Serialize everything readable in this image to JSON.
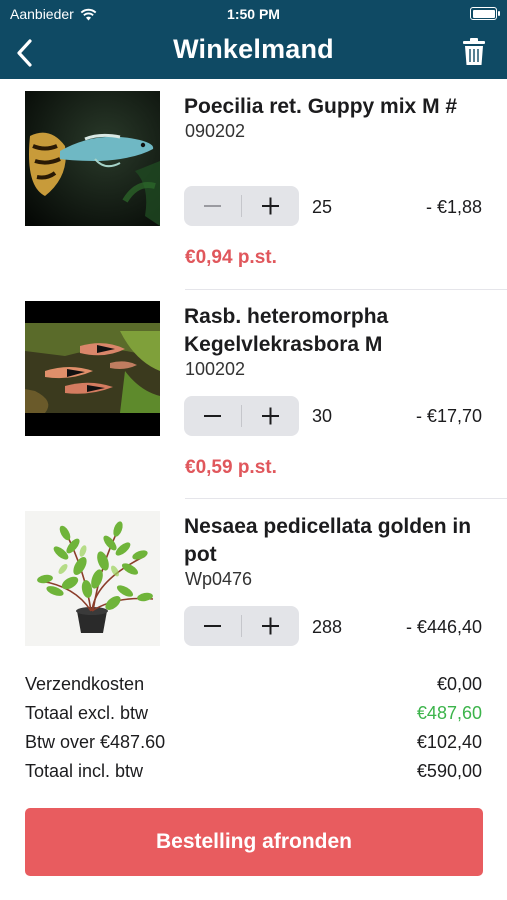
{
  "status_bar": {
    "carrier": "Aanbieder",
    "time": "1:50 PM"
  },
  "header": {
    "title": "Winkelmand",
    "back_icon": "chevron-left-icon",
    "delete_icon": "trash-icon",
    "background": "#0f4a64"
  },
  "items": [
    {
      "name": "Poecilia ret.   Guppy mix M #",
      "code": "090202",
      "quantity": "25",
      "line_total": "- €1,88",
      "unit_price": "€0,94 p.st.",
      "image": "guppy-fish-photo"
    },
    {
      "name": "Rasb. heteromorpha Kegelvlekrasbora M",
      "code": "100202",
      "quantity": "30",
      "line_total": "- €17,70",
      "unit_price": "€0,59 p.st.",
      "image": "rasbora-fish-photo"
    },
    {
      "name": "Nesaea pedicellata golden in pot",
      "code": "Wp0476",
      "quantity": "288",
      "line_total": "- €446,40",
      "image": "plant-in-pot-photo"
    }
  ],
  "summary": [
    {
      "label": "Verzendkosten",
      "value": "€0,00"
    },
    {
      "label": "Totaal excl. btw",
      "value": "€487,60",
      "color": "#3cb44b"
    },
    {
      "label": "Btw over €487.60",
      "value": "€102,40"
    },
    {
      "label": "Totaal incl. btw",
      "value": "€590,00"
    }
  ],
  "checkout_button": {
    "label": "Bestelling afronden",
    "color": "#e85c5f"
  },
  "colors": {
    "price": "#e0575c",
    "header": "#0f4a64"
  }
}
